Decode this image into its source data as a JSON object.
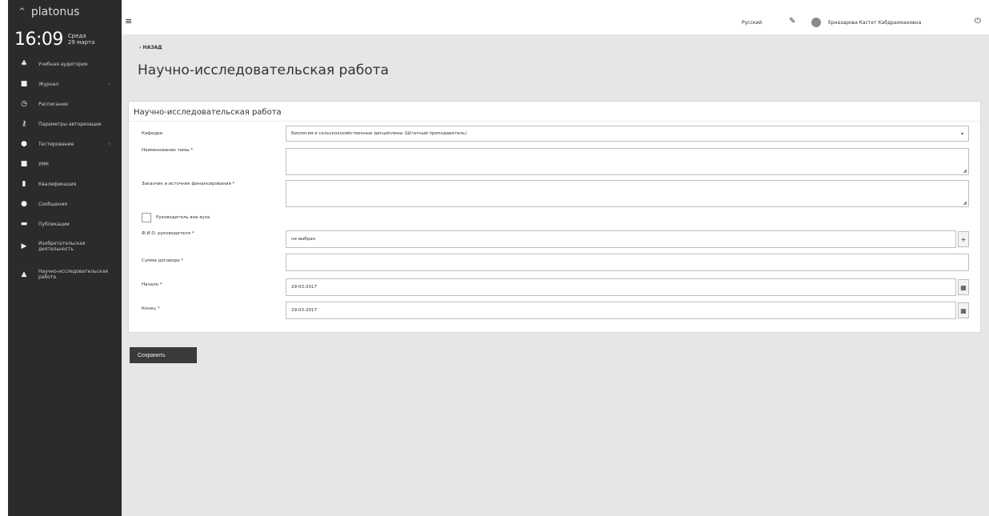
{
  "sidebar": {
    "brand": "platonus",
    "time": "16:09",
    "weekday": "Среда",
    "date": "29 марта",
    "items": [
      {
        "icon": "classroom-icon",
        "glyph": "♣",
        "label": "Учебная аудитория",
        "caret": ""
      },
      {
        "icon": "journal-icon",
        "glyph": "■",
        "label": "Журнал",
        "caret": "‹"
      },
      {
        "icon": "schedule-icon",
        "glyph": "◷",
        "label": "Расписание",
        "caret": ""
      },
      {
        "icon": "key-icon",
        "glyph": "⚷",
        "label": "Параметры авторизации",
        "caret": ""
      },
      {
        "icon": "testing-icon",
        "glyph": "●",
        "label": "Тестирование",
        "caret": "‹"
      },
      {
        "icon": "umk-icon",
        "glyph": "■",
        "label": "УМК",
        "caret": ""
      },
      {
        "icon": "qualification-icon",
        "glyph": "▮",
        "label": "Квалификация",
        "caret": ""
      },
      {
        "icon": "messages-icon",
        "glyph": "●",
        "label": "Сообщения",
        "caret": ""
      },
      {
        "icon": "publications-icon",
        "glyph": "▬",
        "label": "Публикации",
        "caret": ""
      },
      {
        "icon": "invention-icon",
        "glyph": "▶",
        "label": "Изобретательская деятельность",
        "caret": ""
      },
      {
        "icon": "flask-icon",
        "glyph": "▲",
        "label": "Научно-исследовательская работа",
        "caret": ""
      }
    ]
  },
  "topbar": {
    "language": "Русский",
    "user": "Ерназарова Кастет Кабдрахмановна"
  },
  "main": {
    "back_label": "‹ НАЗАД",
    "page_title": "Научно-исследовательская работа",
    "card_title": "Научно-исследовательская работа",
    "fields": {
      "department_label": "Кафедра",
      "department_value": "Биология и сельскохозяйственные дисциплины (Штатный преподаватель)",
      "topic_label": "Наименование темы *",
      "customer_label": "Заказчик и источник финансирования *",
      "external_supervisor_label": "Руководитель вне вуза",
      "supervisor_label": "Ф.И.О. руководителя *",
      "supervisor_value": "не выбран",
      "contract_sum_label": "Сумма договора *",
      "start_label": "Начало *",
      "start_value": "29-03-2017",
      "end_label": "Конец *",
      "end_value": "29-03-2017"
    },
    "save_label": "Сохранить"
  }
}
